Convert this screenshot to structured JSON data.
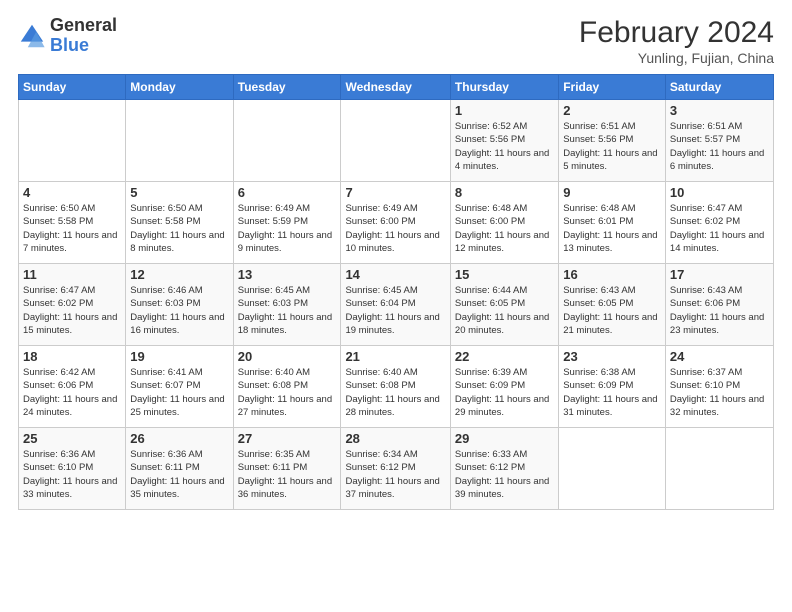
{
  "header": {
    "logo_general": "General",
    "logo_blue": "Blue",
    "month_year": "February 2024",
    "location": "Yunling, Fujian, China"
  },
  "weekdays": [
    "Sunday",
    "Monday",
    "Tuesday",
    "Wednesday",
    "Thursday",
    "Friday",
    "Saturday"
  ],
  "weeks": [
    [
      {
        "day": "",
        "info": ""
      },
      {
        "day": "",
        "info": ""
      },
      {
        "day": "",
        "info": ""
      },
      {
        "day": "",
        "info": ""
      },
      {
        "day": "1",
        "info": "Sunrise: 6:52 AM\nSunset: 5:56 PM\nDaylight: 11 hours and 4 minutes."
      },
      {
        "day": "2",
        "info": "Sunrise: 6:51 AM\nSunset: 5:56 PM\nDaylight: 11 hours and 5 minutes."
      },
      {
        "day": "3",
        "info": "Sunrise: 6:51 AM\nSunset: 5:57 PM\nDaylight: 11 hours and 6 minutes."
      }
    ],
    [
      {
        "day": "4",
        "info": "Sunrise: 6:50 AM\nSunset: 5:58 PM\nDaylight: 11 hours and 7 minutes."
      },
      {
        "day": "5",
        "info": "Sunrise: 6:50 AM\nSunset: 5:58 PM\nDaylight: 11 hours and 8 minutes."
      },
      {
        "day": "6",
        "info": "Sunrise: 6:49 AM\nSunset: 5:59 PM\nDaylight: 11 hours and 9 minutes."
      },
      {
        "day": "7",
        "info": "Sunrise: 6:49 AM\nSunset: 6:00 PM\nDaylight: 11 hours and 10 minutes."
      },
      {
        "day": "8",
        "info": "Sunrise: 6:48 AM\nSunset: 6:00 PM\nDaylight: 11 hours and 12 minutes."
      },
      {
        "day": "9",
        "info": "Sunrise: 6:48 AM\nSunset: 6:01 PM\nDaylight: 11 hours and 13 minutes."
      },
      {
        "day": "10",
        "info": "Sunrise: 6:47 AM\nSunset: 6:02 PM\nDaylight: 11 hours and 14 minutes."
      }
    ],
    [
      {
        "day": "11",
        "info": "Sunrise: 6:47 AM\nSunset: 6:02 PM\nDaylight: 11 hours and 15 minutes."
      },
      {
        "day": "12",
        "info": "Sunrise: 6:46 AM\nSunset: 6:03 PM\nDaylight: 11 hours and 16 minutes."
      },
      {
        "day": "13",
        "info": "Sunrise: 6:45 AM\nSunset: 6:03 PM\nDaylight: 11 hours and 18 minutes."
      },
      {
        "day": "14",
        "info": "Sunrise: 6:45 AM\nSunset: 6:04 PM\nDaylight: 11 hours and 19 minutes."
      },
      {
        "day": "15",
        "info": "Sunrise: 6:44 AM\nSunset: 6:05 PM\nDaylight: 11 hours and 20 minutes."
      },
      {
        "day": "16",
        "info": "Sunrise: 6:43 AM\nSunset: 6:05 PM\nDaylight: 11 hours and 21 minutes."
      },
      {
        "day": "17",
        "info": "Sunrise: 6:43 AM\nSunset: 6:06 PM\nDaylight: 11 hours and 23 minutes."
      }
    ],
    [
      {
        "day": "18",
        "info": "Sunrise: 6:42 AM\nSunset: 6:06 PM\nDaylight: 11 hours and 24 minutes."
      },
      {
        "day": "19",
        "info": "Sunrise: 6:41 AM\nSunset: 6:07 PM\nDaylight: 11 hours and 25 minutes."
      },
      {
        "day": "20",
        "info": "Sunrise: 6:40 AM\nSunset: 6:08 PM\nDaylight: 11 hours and 27 minutes."
      },
      {
        "day": "21",
        "info": "Sunrise: 6:40 AM\nSunset: 6:08 PM\nDaylight: 11 hours and 28 minutes."
      },
      {
        "day": "22",
        "info": "Sunrise: 6:39 AM\nSunset: 6:09 PM\nDaylight: 11 hours and 29 minutes."
      },
      {
        "day": "23",
        "info": "Sunrise: 6:38 AM\nSunset: 6:09 PM\nDaylight: 11 hours and 31 minutes."
      },
      {
        "day": "24",
        "info": "Sunrise: 6:37 AM\nSunset: 6:10 PM\nDaylight: 11 hours and 32 minutes."
      }
    ],
    [
      {
        "day": "25",
        "info": "Sunrise: 6:36 AM\nSunset: 6:10 PM\nDaylight: 11 hours and 33 minutes."
      },
      {
        "day": "26",
        "info": "Sunrise: 6:36 AM\nSunset: 6:11 PM\nDaylight: 11 hours and 35 minutes."
      },
      {
        "day": "27",
        "info": "Sunrise: 6:35 AM\nSunset: 6:11 PM\nDaylight: 11 hours and 36 minutes."
      },
      {
        "day": "28",
        "info": "Sunrise: 6:34 AM\nSunset: 6:12 PM\nDaylight: 11 hours and 37 minutes."
      },
      {
        "day": "29",
        "info": "Sunrise: 6:33 AM\nSunset: 6:12 PM\nDaylight: 11 hours and 39 minutes."
      },
      {
        "day": "",
        "info": ""
      },
      {
        "day": "",
        "info": ""
      }
    ]
  ]
}
